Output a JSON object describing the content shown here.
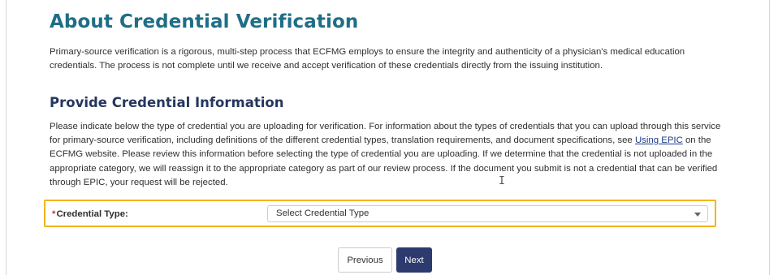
{
  "about": {
    "title": "About Credential Verification",
    "paragraph_line1": "Primary-source verification is a rigorous, multi-step process that ECFMG employs to ensure the integrity and authenticity of a physician's medical education credentials.",
    "paragraph_line2": "The process is not complete until we receive and accept verification of these credentials directly from the issuing institution."
  },
  "provide": {
    "title": "Provide Credential Information",
    "text_before_link": "Please indicate below the type of credential you are uploading for verification. For information about the types of credentials that you can upload through this service for primary-source verification, including definitions of the different credential types, translation requirements, and document specifications, see ",
    "link_text": "Using EPIC",
    "text_after_link": " on the ECFMG website. Please review this information before selecting the type of credential you are uploading. If we determine that the credential is not uploaded in the appropriate category, we will reassign it to the appropriate category as part of our review process. If the document you submit is not a credential that can be verified through EPIC, your request will be rejected."
  },
  "credential_type": {
    "required_marker": "*",
    "label": "Credential Type:",
    "placeholder": "Select Credential Type",
    "focus_color": "#f2b51c"
  },
  "buttons": {
    "previous": "Previous",
    "next": "Next"
  },
  "colors": {
    "heading_teal": "#1f6e86",
    "heading_navy": "#25375f",
    "next_button": "#2c3a6e",
    "link": "#1a3c8e",
    "required": "#d0312d"
  },
  "icons": {
    "text_cursor": "I-beam cursor",
    "dropdown": "caret-down"
  }
}
